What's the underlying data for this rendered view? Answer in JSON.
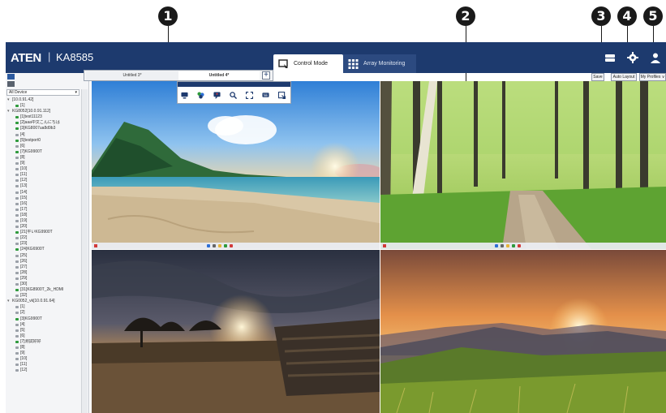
{
  "callouts": [
    "1",
    "2",
    "3",
    "4",
    "5"
  ],
  "header": {
    "logo": "ATEN",
    "separator": "|",
    "model": "KA8585",
    "tabs": [
      {
        "label": "Control Mode",
        "icon": "control-mode-icon",
        "active": true
      },
      {
        "label": "Array Monitoring",
        "icon": "grid-icon",
        "active": false
      }
    ],
    "icons": [
      "storage-icon",
      "gear-icon",
      "user-icon"
    ]
  },
  "buttons": {
    "save": "Save",
    "auto_layout": "Auto Layout",
    "my_profiles": "My Profiles ∨"
  },
  "layout_tabs": [
    {
      "label": "Untitled 3*",
      "active": false
    },
    {
      "label": "Untitled 4*",
      "active": true
    }
  ],
  "add_tab": "+",
  "device_filter": {
    "value": "All Device",
    "caret": "▾"
  },
  "tree": [
    {
      "type": "group",
      "label": "[10.0.91.42]"
    },
    {
      "type": "item",
      "label": "[1]",
      "on": true
    },
    {
      "type": "group",
      "label": "KG8052[10.0.91.112]"
    },
    {
      "type": "item",
      "label": "[1]test11123",
      "on": true
    },
    {
      "type": "item",
      "label": "[2]aaa中文こんにちは",
      "on": true
    },
    {
      "type": "item",
      "label": "[3]KG8007ua8d9b3",
      "on": true
    },
    {
      "type": "item",
      "label": "[4]",
      "on": false
    },
    {
      "type": "item",
      "label": "[5]testport0",
      "on": true
    },
    {
      "type": "item",
      "label": "[6]",
      "on": false
    },
    {
      "type": "item",
      "label": "[7]KG9900T",
      "on": true
    },
    {
      "type": "item",
      "label": "[8]",
      "on": false
    },
    {
      "type": "item",
      "label": "[9]",
      "on": false
    },
    {
      "type": "item",
      "label": "[10]",
      "on": false
    },
    {
      "type": "item",
      "label": "[11]",
      "on": false
    },
    {
      "type": "item",
      "label": "[12]",
      "on": false
    },
    {
      "type": "item",
      "label": "[13]",
      "on": false
    },
    {
      "type": "item",
      "label": "[14]",
      "on": false
    },
    {
      "type": "item",
      "label": "[15]",
      "on": false
    },
    {
      "type": "item",
      "label": "[16]",
      "on": false
    },
    {
      "type": "item",
      "label": "[17]",
      "on": false
    },
    {
      "type": "item",
      "label": "[18]",
      "on": false
    },
    {
      "type": "item",
      "label": "[19]",
      "on": false
    },
    {
      "type": "item",
      "label": "[20]",
      "on": false
    },
    {
      "type": "item",
      "label": "[21]平いKG9900T",
      "on": true
    },
    {
      "type": "item",
      "label": "[22]",
      "on": false
    },
    {
      "type": "item",
      "label": "[23]",
      "on": false
    },
    {
      "type": "item",
      "label": "[24]KG6900T",
      "on": true
    },
    {
      "type": "item",
      "label": "[25]",
      "on": false
    },
    {
      "type": "item",
      "label": "[26]",
      "on": false
    },
    {
      "type": "item",
      "label": "[27]",
      "on": false
    },
    {
      "type": "item",
      "label": "[28]",
      "on": false
    },
    {
      "type": "item",
      "label": "[29]",
      "on": false
    },
    {
      "type": "item",
      "label": "[30]",
      "on": false
    },
    {
      "type": "item",
      "label": "[31]KG8900T_2k_HDMI",
      "on": true
    },
    {
      "type": "item",
      "label": "[32]",
      "on": false
    },
    {
      "type": "group",
      "label": "KG0052_vk[10.0.91.64]"
    },
    {
      "type": "item",
      "label": "[1]",
      "on": false
    },
    {
      "type": "item",
      "label": "[2]",
      "on": false
    },
    {
      "type": "item",
      "label": "[3]KG9900T",
      "on": true
    },
    {
      "type": "item",
      "label": "[4]",
      "on": false
    },
    {
      "type": "item",
      "label": "[5]",
      "on": false
    },
    {
      "type": "item",
      "label": "[6]",
      "on": false
    },
    {
      "type": "item",
      "label": "[7]测試好好",
      "on": true
    },
    {
      "type": "item",
      "label": "[8]",
      "on": false
    },
    {
      "type": "item",
      "label": "[9]",
      "on": false
    },
    {
      "type": "item",
      "label": "[10]",
      "on": false
    },
    {
      "type": "item",
      "label": "[11]",
      "on": false
    },
    {
      "type": "item",
      "label": "[12]",
      "on": false
    }
  ],
  "floating_toolbar": {
    "icons": [
      "monitor-icon",
      "color-icon",
      "chat-icon",
      "zoom-in-icon",
      "fullscreen-icon",
      "keyboard-icon",
      "exit-icon"
    ]
  },
  "screens": [
    {
      "name": "screen-beach"
    },
    {
      "name": "screen-forest-path"
    },
    {
      "name": "screen-sunset-bunker"
    },
    {
      "name": "screen-mountain-sunrise"
    }
  ],
  "colors": {
    "header_bg": "#1d3a6e",
    "online": "#2e9a3c",
    "offline": "#9aa0a8"
  }
}
